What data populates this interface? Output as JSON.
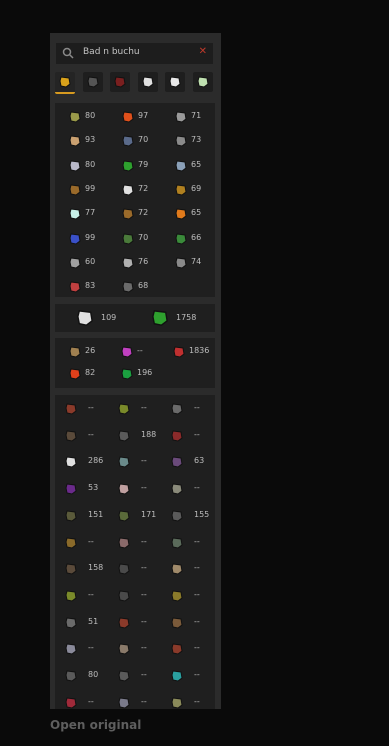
{
  "search": {
    "value": "Bad n buchu",
    "clear_icon": "close-icon",
    "icon": "search-icon"
  },
  "tabs": [
    {
      "name": "overview-tab",
      "icon": "trophy-icon",
      "color": "#d9a21b",
      "active": true
    },
    {
      "name": "bosses-tab",
      "icon": "dark-helm-icon",
      "color": "#555555",
      "active": false
    },
    {
      "name": "raids-tab",
      "icon": "red-helm-icon",
      "color": "#7a1f1f",
      "active": false
    },
    {
      "name": "minigames-tab",
      "icon": "white-helm-icon",
      "color": "#e0e0e0",
      "active": false
    },
    {
      "name": "skull-tab",
      "icon": "skull-icon",
      "color": "#e8e8e8",
      "active": false
    },
    {
      "name": "clue-tab",
      "icon": "compass-icon",
      "color": "#bfe0b0",
      "active": false
    }
  ],
  "skills": [
    {
      "icon": "attack-icon",
      "color": "#9a9a4a",
      "value": "80"
    },
    {
      "icon": "hitpoints-icon",
      "color": "#e0501b",
      "value": "97"
    },
    {
      "icon": "mining-icon",
      "color": "#9a9a9a",
      "value": "71"
    },
    {
      "icon": "strength-icon",
      "color": "#c9a070",
      "value": "93"
    },
    {
      "icon": "agility-icon",
      "color": "#5a6a8a",
      "value": "70"
    },
    {
      "icon": "smithing-icon",
      "color": "#8a8a8a",
      "value": "73"
    },
    {
      "icon": "defence-icon",
      "color": "#b8b8c8",
      "value": "80"
    },
    {
      "icon": "herblore-icon",
      "color": "#2ea02e",
      "value": "79"
    },
    {
      "icon": "fishing-icon",
      "color": "#8aa0b8",
      "value": "65"
    },
    {
      "icon": "ranged-icon",
      "color": "#9a6a2a",
      "value": "99"
    },
    {
      "icon": "thieving-icon",
      "color": "#e0e0e0",
      "value": "72"
    },
    {
      "icon": "cooking-icon",
      "color": "#b08020",
      "value": "69"
    },
    {
      "icon": "prayer-icon",
      "color": "#c8f0e8",
      "value": "77"
    },
    {
      "icon": "crafting-icon",
      "color": "#9a6a2a",
      "value": "72"
    },
    {
      "icon": "firemaking-icon",
      "color": "#e07a1b",
      "value": "65"
    },
    {
      "icon": "magic-icon",
      "color": "#3a50c8",
      "value": "99"
    },
    {
      "icon": "fletching-icon",
      "color": "#4a7a3a",
      "value": "70"
    },
    {
      "icon": "woodcutting-icon",
      "color": "#3a8a3a",
      "value": "66"
    },
    {
      "icon": "runecraft-icon",
      "color": "#a0a0a0",
      "value": "60"
    },
    {
      "icon": "slayer-icon",
      "color": "#b0b0b0",
      "value": "76"
    },
    {
      "icon": "farming-icon",
      "color": "#8a8a8a",
      "value": "74"
    },
    {
      "icon": "hunter-icon",
      "color": "#c04040",
      "value": "83"
    },
    {
      "icon": "construction-icon",
      "color": "#6a6a6a",
      "value": "68"
    }
  ],
  "totals": [
    {
      "icon": "combat-icon",
      "color": "#e0e0e0",
      "value": "109"
    },
    {
      "icon": "total-level-icon",
      "color": "#2ea02e",
      "value": "1758"
    }
  ],
  "activities": [
    {
      "icon": "clue-scroll-icon",
      "color": "#a08050",
      "value": "26"
    },
    {
      "icon": "league-points-icon",
      "color": "#c040c0",
      "value": "--"
    },
    {
      "icon": "bounty-hunter-icon",
      "color": "#c03030",
      "value": "1836"
    },
    {
      "icon": "pvp-icon",
      "color": "#e0401b",
      "value": "82"
    },
    {
      "icon": "soul-wars-icon",
      "color": "#1ba040",
      "value": "196"
    }
  ],
  "bosses": [
    {
      "icon": "boss-1-icon",
      "color": "#8a3a2a",
      "value": "--"
    },
    {
      "icon": "boss-2-icon",
      "color": "#7a8a2a",
      "value": "--"
    },
    {
      "icon": "boss-3-icon",
      "color": "#6a6a6a",
      "value": "--"
    },
    {
      "icon": "boss-4-icon",
      "color": "#5a4a3a",
      "value": "--"
    },
    {
      "icon": "boss-5-icon",
      "color": "#5a5a5a",
      "value": "188"
    },
    {
      "icon": "boss-6-icon",
      "color": "#8a2a2a",
      "value": "--"
    },
    {
      "icon": "boss-7-icon",
      "color": "#e0e0e0",
      "value": "286"
    },
    {
      "icon": "boss-8-icon",
      "color": "#6a8a8a",
      "value": "--"
    },
    {
      "icon": "boss-9-icon",
      "color": "#6a4a7a",
      "value": "63"
    },
    {
      "icon": "boss-10-icon",
      "color": "#6a2a8a",
      "value": "53"
    },
    {
      "icon": "boss-11-icon",
      "color": "#c0a0a0",
      "value": "--"
    },
    {
      "icon": "boss-12-icon",
      "color": "#8a8a7a",
      "value": "--"
    },
    {
      "icon": "boss-13-icon",
      "color": "#5a5a3a",
      "value": "151"
    },
    {
      "icon": "boss-14-icon",
      "color": "#5a6a3a",
      "value": "171"
    },
    {
      "icon": "boss-15-icon",
      "color": "#5a5a5a",
      "value": "155"
    },
    {
      "icon": "boss-16-icon",
      "color": "#8a6a2a",
      "value": "--"
    },
    {
      "icon": "boss-17-icon",
      "color": "#8a6a6a",
      "value": "--"
    },
    {
      "icon": "boss-18-icon",
      "color": "#5a6a5a",
      "value": "--"
    },
    {
      "icon": "boss-19-icon",
      "color": "#5a4a3a",
      "value": "158"
    },
    {
      "icon": "boss-20-icon",
      "color": "#4a4a4a",
      "value": "--"
    },
    {
      "icon": "boss-21-icon",
      "color": "#a08a6a",
      "value": "--"
    },
    {
      "icon": "boss-22-icon",
      "color": "#7a8a2a",
      "value": "--"
    },
    {
      "icon": "boss-23-icon",
      "color": "#4a4a4a",
      "value": "--"
    },
    {
      "icon": "boss-24-icon",
      "color": "#8a7a2a",
      "value": "--"
    },
    {
      "icon": "boss-25-icon",
      "color": "#6a6a6a",
      "value": "51"
    },
    {
      "icon": "boss-26-icon",
      "color": "#8a3a2a",
      "value": "--"
    },
    {
      "icon": "boss-27-icon",
      "color": "#7a5a3a",
      "value": "--"
    },
    {
      "icon": "boss-28-icon",
      "color": "#8a8a9a",
      "value": "--"
    },
    {
      "icon": "boss-29-icon",
      "color": "#8a7a6a",
      "value": "--"
    },
    {
      "icon": "boss-30-icon",
      "color": "#8a3a2a",
      "value": "--"
    },
    {
      "icon": "boss-31-icon",
      "color": "#5a5a5a",
      "value": "80"
    },
    {
      "icon": "boss-32-icon",
      "color": "#5a5a5a",
      "value": "--"
    },
    {
      "icon": "boss-33-icon",
      "color": "#2aa0a0",
      "value": "--"
    },
    {
      "icon": "boss-34-icon",
      "color": "#a02a3a",
      "value": "--"
    },
    {
      "icon": "boss-35-icon",
      "color": "#7a7a8a",
      "value": "--"
    },
    {
      "icon": "boss-36-icon",
      "color": "#8a8a5a",
      "value": "--"
    }
  ],
  "footer": {
    "open_original": "Open original"
  }
}
